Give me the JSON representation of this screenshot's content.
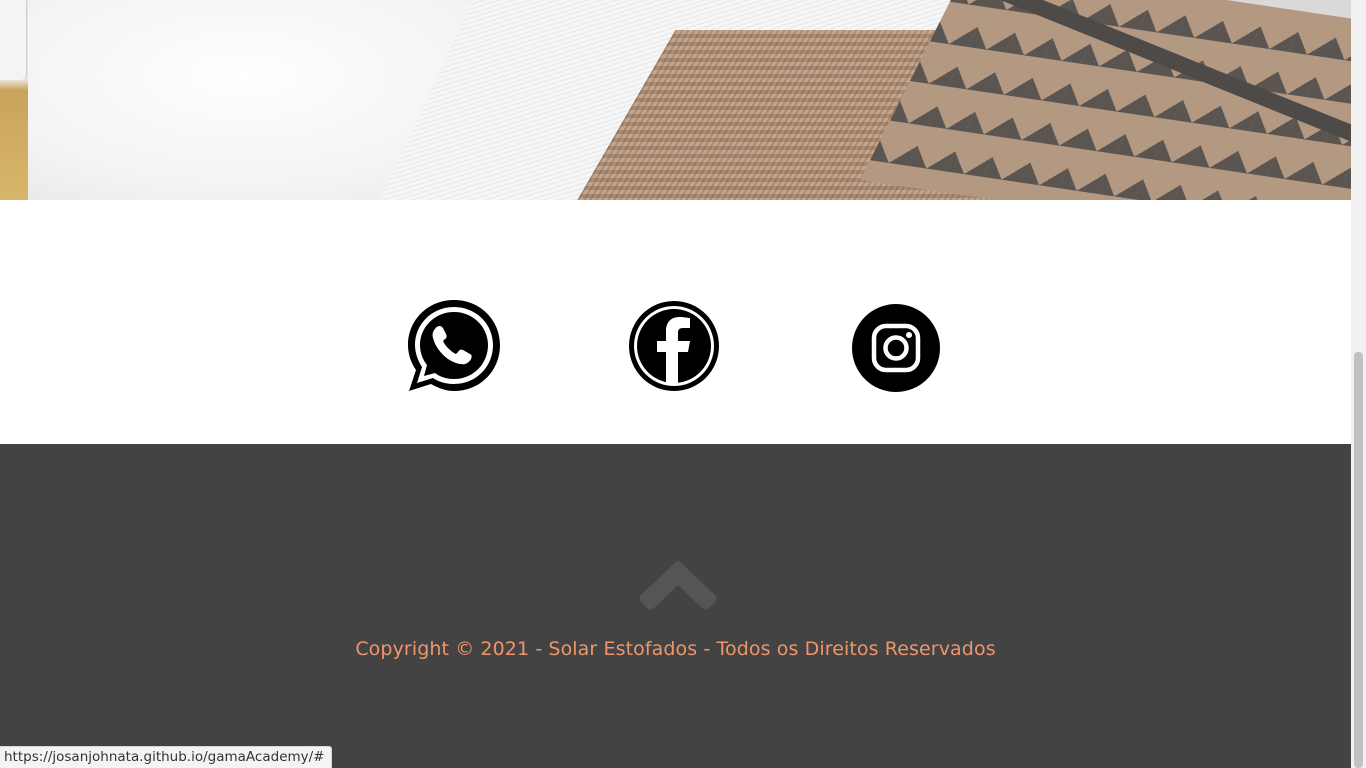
{
  "hero": {
    "image_alt": "bedding photo",
    "icon": "bed-photo"
  },
  "social": {
    "links": [
      {
        "name": "WhatsApp",
        "icon": "whatsapp-icon"
      },
      {
        "name": "Facebook",
        "icon": "facebook-icon"
      },
      {
        "name": "Instagram",
        "icon": "instagram-icon"
      }
    ]
  },
  "footer": {
    "back_to_top_icon": "chevron-up-icon",
    "copyright": "Copyright © 2021 - Solar Estofados - Todos os Direitos Reservados",
    "copyright_color": "#f0956a",
    "background_color": "#434343"
  },
  "status_bar": {
    "url": "https://josanjohnata.github.io/gamaAcademy/#"
  }
}
